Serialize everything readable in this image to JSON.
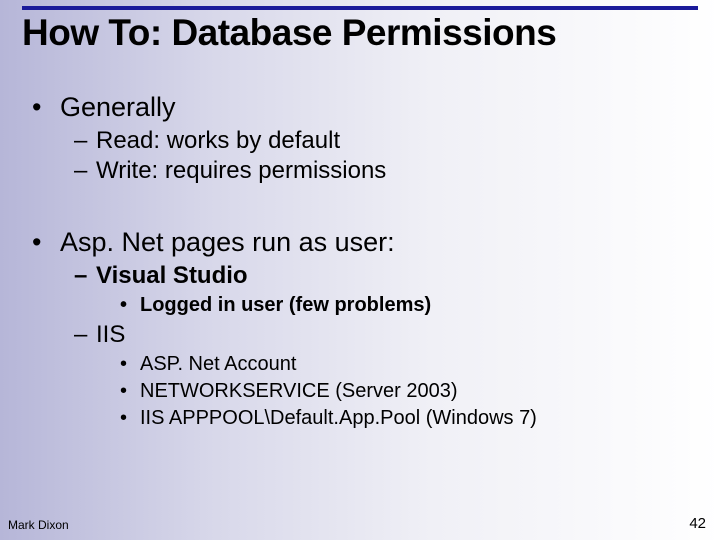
{
  "title": "How To: Database Permissions",
  "bullets": {
    "b1": "Generally",
    "b1a": "Read: works by default",
    "b1b": "Write: requires permissions",
    "b2": "Asp. Net pages run as user:",
    "b2a": "Visual Studio",
    "b2a1": "Logged in user (few problems)",
    "b2b": "IIS",
    "b2b1": "ASP. Net Account",
    "b2b2": "NETWORKSERVICE (Server 2003)",
    "b2b3": "IIS APPPOOL\\Default.App.Pool (Windows 7)"
  },
  "footer": {
    "author": "Mark Dixon",
    "page": "42"
  }
}
